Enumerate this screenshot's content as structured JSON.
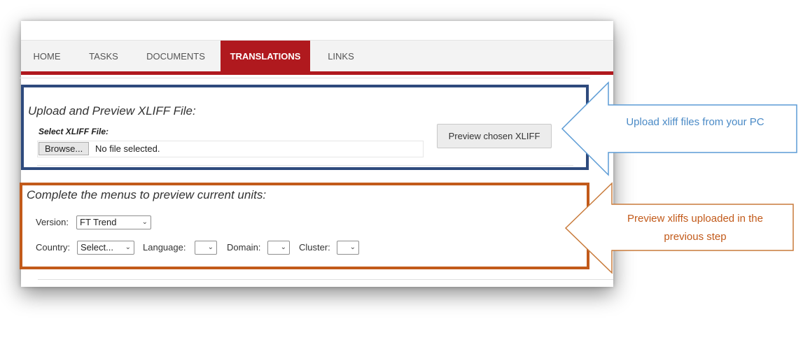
{
  "nav": {
    "tabs": [
      {
        "label": "HOME",
        "active": false
      },
      {
        "label": "TASKS",
        "active": false
      },
      {
        "label": "DOCUMENTS",
        "active": false
      },
      {
        "label": "TRANSLATIONS",
        "active": true
      },
      {
        "label": "LINKS",
        "active": false
      }
    ]
  },
  "upload": {
    "title": "Upload and Preview XLIFF File:",
    "file_label": "Select XLIFF File:",
    "browse_label": "Browse...",
    "file_status": "No file selected.",
    "preview_button": "Preview chosen XLIFF"
  },
  "menus": {
    "title": "Complete the menus to preview current units:",
    "version_label": "Version:",
    "version_value": "FT Trend",
    "country_label": "Country:",
    "country_value": "Select...",
    "language_label": "Language:",
    "language_value": "",
    "domain_label": "Domain:",
    "domain_value": "",
    "cluster_label": "Cluster:",
    "cluster_value": ""
  },
  "callouts": {
    "upload": "Upload xliff files from your PC",
    "preview_line1": "Preview xliffs uploaded in the",
    "preview_line2": "previous step"
  },
  "colors": {
    "accent_red": "#b0191e",
    "upload_box": "#2e4a7d",
    "menus_box": "#c25a1a",
    "callout_blue": "#4a8ac6",
    "callout_orange": "#c25a1a"
  }
}
